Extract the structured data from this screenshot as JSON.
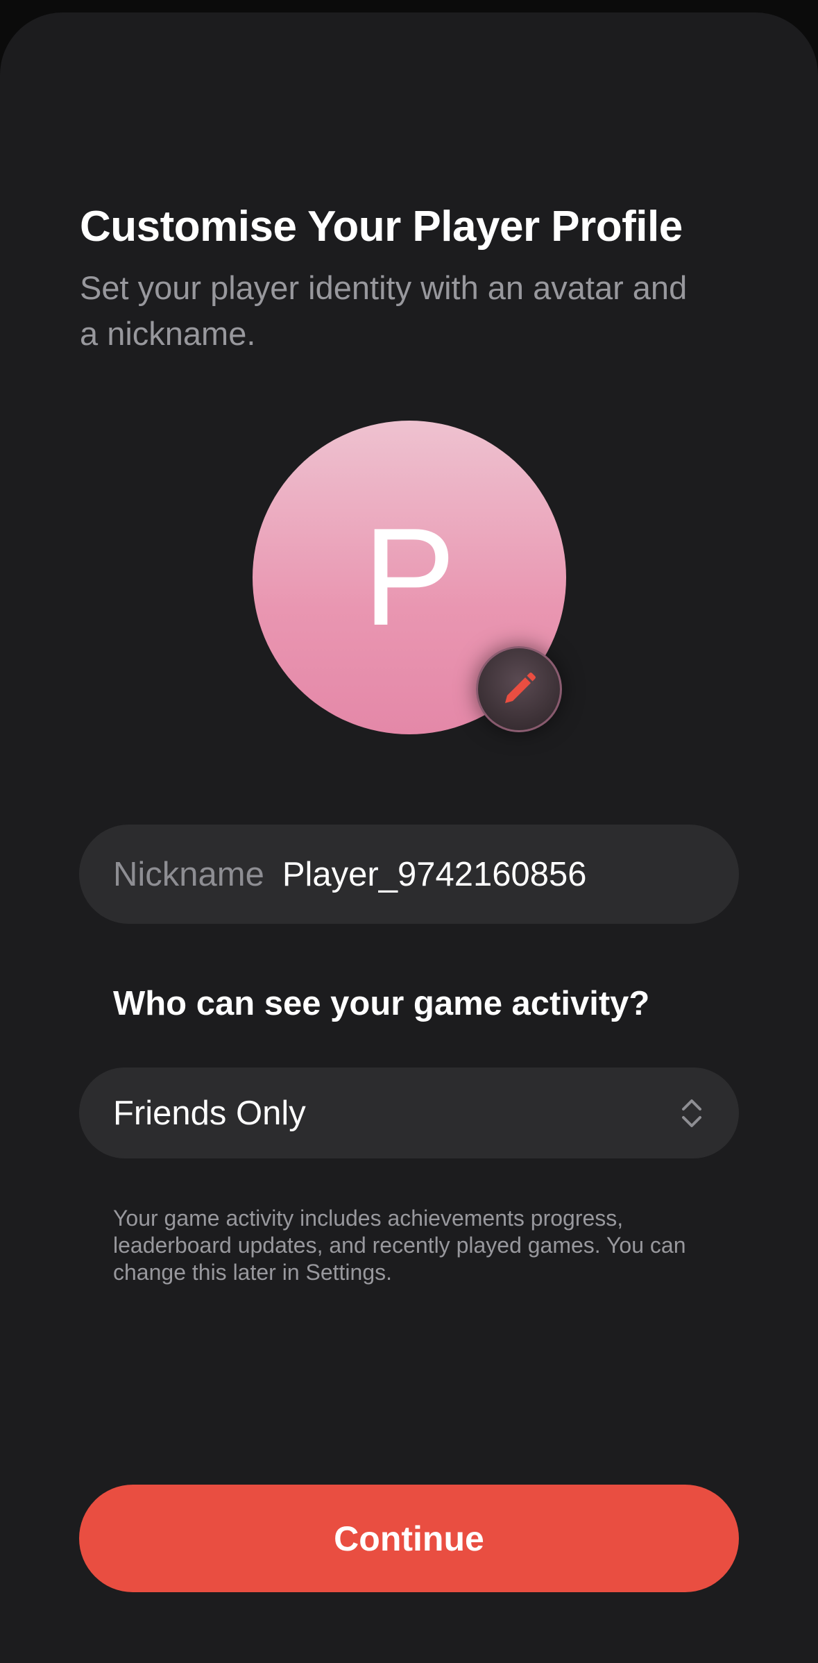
{
  "header": {
    "title": "Customise Your Player Profile",
    "subtitle": "Set your player identity with an avatar and a nickname."
  },
  "avatar": {
    "initial": "P",
    "edit_icon": "pencil-icon",
    "colors": {
      "top": "#eec2d0",
      "bottom": "#e488a8",
      "pencil": "#e94e41"
    }
  },
  "nickname": {
    "label": "Nickname",
    "value": "Player_9742160856"
  },
  "visibility": {
    "question": "Who can see your game activity?",
    "selected": "Friends Only",
    "selector_icon": "chevron-up-down-icon",
    "note": "Your game activity includes achievements progress, leaderboard updates, and recently played games. You can change this later in Settings."
  },
  "footer": {
    "continue_label": "Continue",
    "accent_color": "#e94e41"
  }
}
